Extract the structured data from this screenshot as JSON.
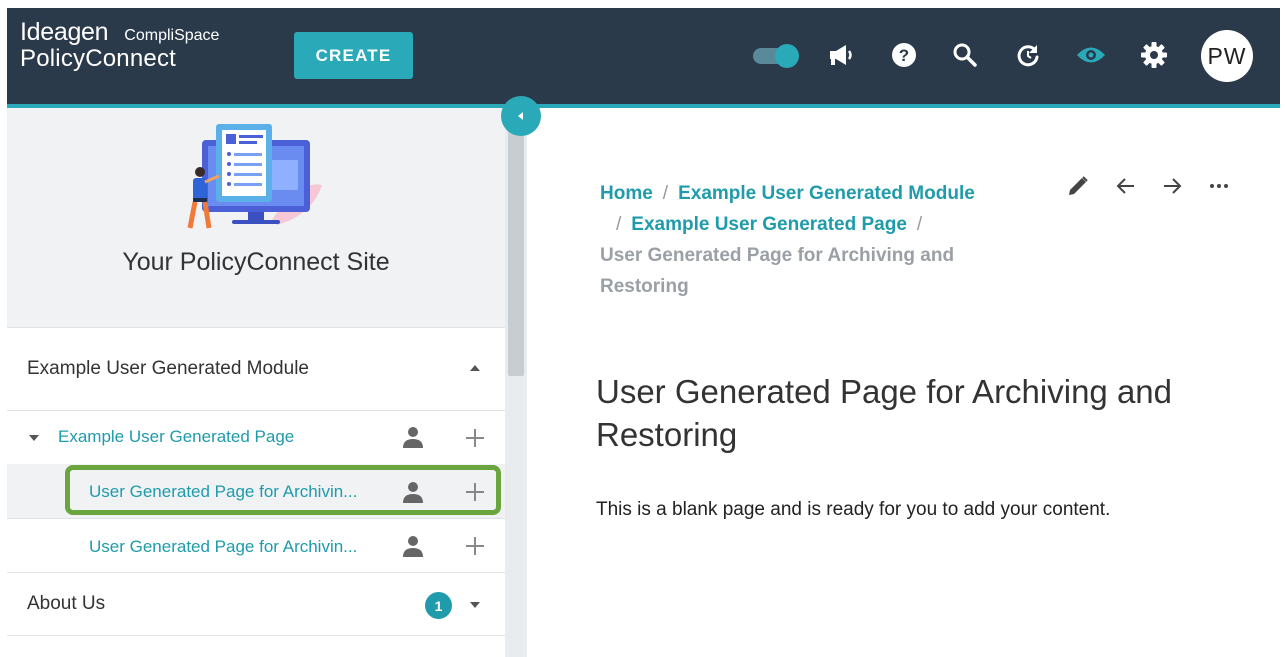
{
  "header": {
    "brand_top": "Ideagen",
    "brand_sub": "CompliSpace",
    "brand_product": "PolicyConnect",
    "create_label": "CREATE",
    "avatar_initials": "PW",
    "toggle_on": true,
    "icons": [
      "toggle",
      "megaphone-icon",
      "help-icon",
      "search-icon",
      "refresh-icon",
      "eye-icon",
      "gear-icon"
    ]
  },
  "sidebar": {
    "site_title": "Your PolicyConnect Site",
    "module": {
      "label": "Example User Generated Module",
      "expanded": true
    },
    "items": [
      {
        "label": "Example User Generated Page",
        "expanded": true
      },
      {
        "label": "User Generated Page for Archivin...",
        "selected": true
      },
      {
        "label": "User Generated Page for Archivin..."
      }
    ],
    "about": {
      "label": "About Us",
      "badge": "1"
    }
  },
  "main": {
    "breadcrumb": {
      "home": "Home",
      "module": "Example User Generated Module",
      "page": "Example User Generated Page",
      "current": "User Generated Page for Archiving and Restoring"
    },
    "title": "User Generated Page for Archiving and Restoring",
    "body": "This is a blank page and is ready for you to add your content."
  },
  "colors": {
    "topbar": "#2b3a4a",
    "accent": "#2aa9b8",
    "link": "#1f9bab",
    "highlight": "#6aa63d"
  }
}
